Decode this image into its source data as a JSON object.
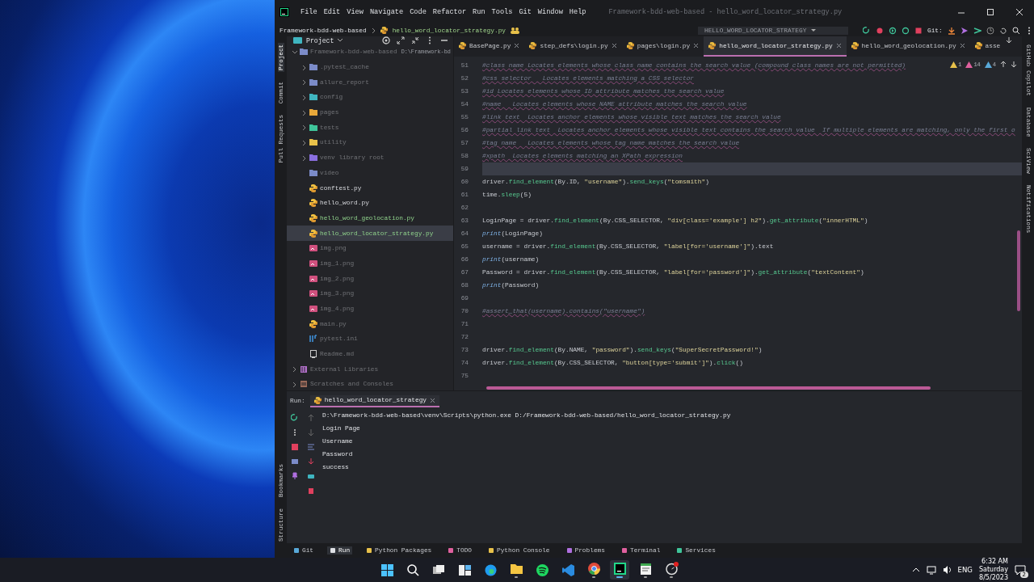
{
  "window": {
    "title": "Framework-bdd-web-based - hello_word_locator_strategy.py",
    "menu": [
      "File",
      "Edit",
      "View",
      "Navigate",
      "Code",
      "Refactor",
      "Run",
      "Tools",
      "Git",
      "Window",
      "Help"
    ]
  },
  "nav_bar": {
    "breadcrumbs": [
      "Framework-bdd-web-based",
      "hello_word_locator_strategy.py"
    ],
    "run_config": "HELLO_WORD_LOCATOR_STRATEGY",
    "git_label": "Git:"
  },
  "left_tool_strip": {
    "top": [
      {
        "label": "Project",
        "selected": true
      },
      {
        "label": "Commit",
        "selected": false
      },
      {
        "label": "Pull Requests",
        "selected": false
      }
    ],
    "bottom": [
      {
        "label": "Bookmarks",
        "selected": false
      },
      {
        "label": "Structure",
        "selected": false
      }
    ]
  },
  "project_panel": {
    "title": "Project",
    "tree": [
      {
        "label": "Framework-bdd-web-based",
        "path": "D:\\Framework-bd",
        "kind": "folder",
        "color": "#7b8bc8",
        "expanded": true,
        "ignored": true,
        "added": false,
        "selected": false,
        "children": [
          {
            "label": ".pytest_cache",
            "kind": "folder",
            "color": "#7b8bc8",
            "expanded": false,
            "ignored": true,
            "added": false,
            "selected": false
          },
          {
            "label": "allure_report",
            "kind": "folder",
            "color": "#7b8bc8",
            "expanded": false,
            "ignored": true,
            "added": false,
            "selected": false
          },
          {
            "label": "config",
            "kind": "folder",
            "color": "#3fb5c0",
            "expanded": false,
            "ignored": true,
            "added": false,
            "selected": false
          },
          {
            "label": "pages",
            "kind": "folder",
            "color": "#e8a83a",
            "expanded": false,
            "ignored": true,
            "added": false,
            "selected": false
          },
          {
            "label": "tests",
            "kind": "folder",
            "color": "#3fc59a",
            "expanded": false,
            "ignored": true,
            "added": false,
            "selected": false
          },
          {
            "label": "utility",
            "kind": "folder",
            "color": "#e8c14a",
            "expanded": false,
            "ignored": true,
            "added": false,
            "selected": false
          },
          {
            "label": "venv  library root",
            "kind": "folder",
            "color": "#8a6fe0",
            "expanded": false,
            "ignored": true,
            "added": false,
            "selected": false
          },
          {
            "label": "video",
            "kind": "empty_folder",
            "color": "#7b8bc8",
            "ignored": true,
            "added": false,
            "selected": false
          },
          {
            "label": "conftest.py",
            "kind": "python",
            "ignored": false,
            "added": false,
            "selected": false
          },
          {
            "label": "hello_word.py",
            "kind": "python",
            "ignored": false,
            "added": false,
            "selected": false
          },
          {
            "label": "hello_word_geolocation.py",
            "kind": "python",
            "ignored": false,
            "added": true,
            "selected": false
          },
          {
            "label": "hello_word_locator_strategy.py",
            "kind": "python",
            "ignored": false,
            "added": true,
            "selected": true
          },
          {
            "label": "img.png",
            "kind": "image",
            "ignored": true,
            "added": false,
            "selected": false
          },
          {
            "label": "img_1.png",
            "kind": "image",
            "ignored": true,
            "added": false,
            "selected": false
          },
          {
            "label": "img_2.png",
            "kind": "image",
            "ignored": true,
            "added": false,
            "selected": false
          },
          {
            "label": "img_3.png",
            "kind": "image",
            "ignored": true,
            "added": false,
            "selected": false
          },
          {
            "label": "img_4.png",
            "kind": "image",
            "ignored": true,
            "added": false,
            "selected": false
          },
          {
            "label": "main.py",
            "kind": "python",
            "ignored": true,
            "added": false,
            "selected": false
          },
          {
            "label": "pytest.ini",
            "kind": "ini",
            "ignored": true,
            "added": false,
            "selected": false
          },
          {
            "label": "Readme.md",
            "kind": "markdown",
            "ignored": true,
            "added": false,
            "selected": false
          }
        ]
      },
      {
        "label": "External Libraries",
        "kind": "library",
        "expanded": false,
        "ignored": true,
        "added": false,
        "selected": false
      },
      {
        "label": "Scratches and Consoles",
        "kind": "scratch",
        "expanded": false,
        "ignored": true,
        "added": false,
        "selected": false
      }
    ]
  },
  "editor": {
    "tabs": [
      {
        "label": "BasePage.py",
        "selected": false
      },
      {
        "label": "step_defs\\login.py",
        "selected": false
      },
      {
        "label": "pages\\login.py",
        "selected": false
      },
      {
        "label": "hello_word_locator_strategy.py",
        "selected": true
      },
      {
        "label": "hello_word_geolocation.py",
        "selected": false
      },
      {
        "label": "asse",
        "selected": false
      }
    ],
    "inspections": {
      "warnings": "1",
      "errors": "14",
      "typos": "4"
    },
    "lines": [
      {
        "number": "51",
        "kind": "comment",
        "current": false,
        "text": "#class name Locates elements whose class name contains the search value (compound class names are not permitted)"
      },
      {
        "number": "52",
        "kind": "comment",
        "current": false,
        "text": "#css selector   Locates elements matching a CSS selector"
      },
      {
        "number": "53",
        "kind": "comment",
        "current": false,
        "text": "#id Locates elements whose ID attribute matches the search value"
      },
      {
        "number": "54",
        "kind": "comment",
        "current": false,
        "text": "#name   Locates elements whose NAME attribute matches the search value"
      },
      {
        "number": "55",
        "kind": "comment",
        "current": false,
        "text": "#link text  Locates anchor elements whose visible text matches the search value"
      },
      {
        "number": "56",
        "kind": "comment",
        "current": false,
        "text": "#partial link text  Locates anchor elements whose visible text contains the search value  If multiple elements are matching, only the first o"
      },
      {
        "number": "57",
        "kind": "comment",
        "current": false,
        "text": "#tag name   Locates elements whose tag name matches the search value"
      },
      {
        "number": "58",
        "kind": "comment",
        "current": false,
        "text": "#xpath  Locates elements matching an XPath expression"
      },
      {
        "number": "59",
        "kind": "blank",
        "current": true
      },
      {
        "number": "60",
        "kind": "code",
        "current": false,
        "text": "driver.find_element(By.ID, \"username\").send_keys(\"tomsmith\")"
      },
      {
        "number": "61",
        "kind": "code",
        "current": false,
        "text": "time.sleep(5)"
      },
      {
        "number": "62",
        "kind": "blank",
        "current": false
      },
      {
        "number": "63",
        "kind": "code",
        "current": false,
        "text": "LoginPage = driver.find_element(By.CSS_SELECTOR, \"div[class='example'] h2\").get_attribute(\"innerHTML\")"
      },
      {
        "number": "64",
        "kind": "code",
        "current": false,
        "text": "print(LoginPage)"
      },
      {
        "number": "65",
        "kind": "code",
        "current": false,
        "text": "username = driver.find_element(By.CSS_SELECTOR, \"label[for='username']\").text"
      },
      {
        "number": "66",
        "kind": "code",
        "current": false,
        "text": "print(username)"
      },
      {
        "number": "67",
        "kind": "code",
        "current": false,
        "text": "Password = driver.find_element(By.CSS_SELECTOR, \"label[for='password']\").get_attribute(\"textContent\")"
      },
      {
        "number": "68",
        "kind": "code",
        "current": false,
        "text": "print(Password)"
      },
      {
        "number": "69",
        "kind": "blank",
        "current": false
      },
      {
        "number": "70",
        "kind": "comment",
        "current": false,
        "text": "#assert_that(username).contains(\"username\")"
      },
      {
        "number": "71",
        "kind": "blank",
        "current": false
      },
      {
        "number": "72",
        "kind": "blank",
        "current": false
      },
      {
        "number": "73",
        "kind": "code",
        "current": false,
        "text": "driver.find_element(By.NAME, \"password\").send_keys(\"SuperSecretPassword!\")"
      },
      {
        "number": "74",
        "kind": "code",
        "current": false,
        "text": "driver.find_element(By.CSS_SELECTOR, \"button[type='submit']\").click()"
      },
      {
        "number": "75",
        "kind": "blank",
        "current": false
      }
    ]
  },
  "right_tool_strip": [
    "GitHub Copilot",
    "Database",
    "SciView",
    "Notifications"
  ],
  "run_panel": {
    "label": "Run:",
    "tab": "hello_word_locator_strategy",
    "output": [
      "D:\\Framework-bdd-web-based\\venv\\Scripts\\python.exe D:/Framework-bdd-web-based/hello_word_locator_strategy.py",
      "Login Page",
      "Username",
      "Password",
      "success"
    ]
  },
  "bottom_tools": [
    {
      "label": "Git",
      "selected": false
    },
    {
      "label": "Run",
      "selected": true
    },
    {
      "label": "Python Packages",
      "selected": false
    },
    {
      "label": "TODO",
      "selected": false
    },
    {
      "label": "Python Console",
      "selected": false
    },
    {
      "label": "Problems",
      "selected": false
    },
    {
      "label": "Terminal",
      "selected": false
    },
    {
      "label": "Services",
      "selected": false
    }
  ],
  "taskbar": {
    "apps": [
      {
        "kind": "start",
        "running": false,
        "active": false,
        "alert": false
      },
      {
        "kind": "search",
        "running": false,
        "active": false,
        "alert": false
      },
      {
        "kind": "taskview",
        "running": false,
        "active": false,
        "alert": false
      },
      {
        "kind": "widgets",
        "running": false,
        "active": false,
        "alert": false
      },
      {
        "kind": "edge",
        "running": false,
        "active": false,
        "alert": false
      },
      {
        "kind": "explorer",
        "running": true,
        "active": false,
        "alert": false
      },
      {
        "kind": "music",
        "running": false,
        "active": false,
        "alert": false
      },
      {
        "kind": "vscode",
        "running": false,
        "active": false,
        "alert": false
      },
      {
        "kind": "chrome",
        "running": true,
        "active": false,
        "alert": false
      },
      {
        "kind": "pycharm",
        "running": true,
        "active": true,
        "alert": false
      },
      {
        "kind": "notepad",
        "running": true,
        "active": false,
        "alert": false
      },
      {
        "kind": "recorder",
        "running": true,
        "active": false,
        "alert": true
      }
    ],
    "language": "ENG",
    "time": "6:32 AM",
    "day": "Saturday",
    "date": "8/5/2023",
    "notifications": "2"
  }
}
